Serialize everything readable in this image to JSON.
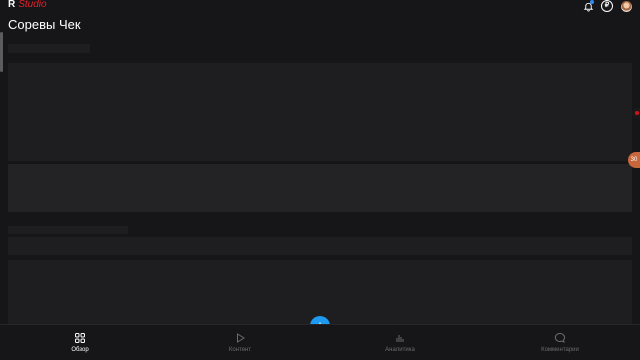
{
  "app": {
    "logo_mark": "R",
    "logo_text": "Studio"
  },
  "header": {
    "title": "Соревы Чек",
    "icons": [
      "bell-icon",
      "ruble-icon",
      "avatar"
    ],
    "ruble_glyph": "₽"
  },
  "side": {
    "badge_text": "30"
  },
  "bottom_nav": {
    "items": [
      {
        "label": "Обзор",
        "icon": "grid-icon",
        "active": true
      },
      {
        "label": "Контент",
        "icon": "play-icon",
        "active": false
      },
      {
        "label": "Аналитика",
        "icon": "bar-chart-icon",
        "active": false
      },
      {
        "label": "Комментарии",
        "icon": "comment-icon",
        "active": false
      }
    ],
    "fab_icon": "plus-icon"
  },
  "colors": {
    "background": "#161618",
    "accent": "#1e9bf0",
    "brand_red": "#e4202c",
    "inactive": "#6b6b70"
  }
}
